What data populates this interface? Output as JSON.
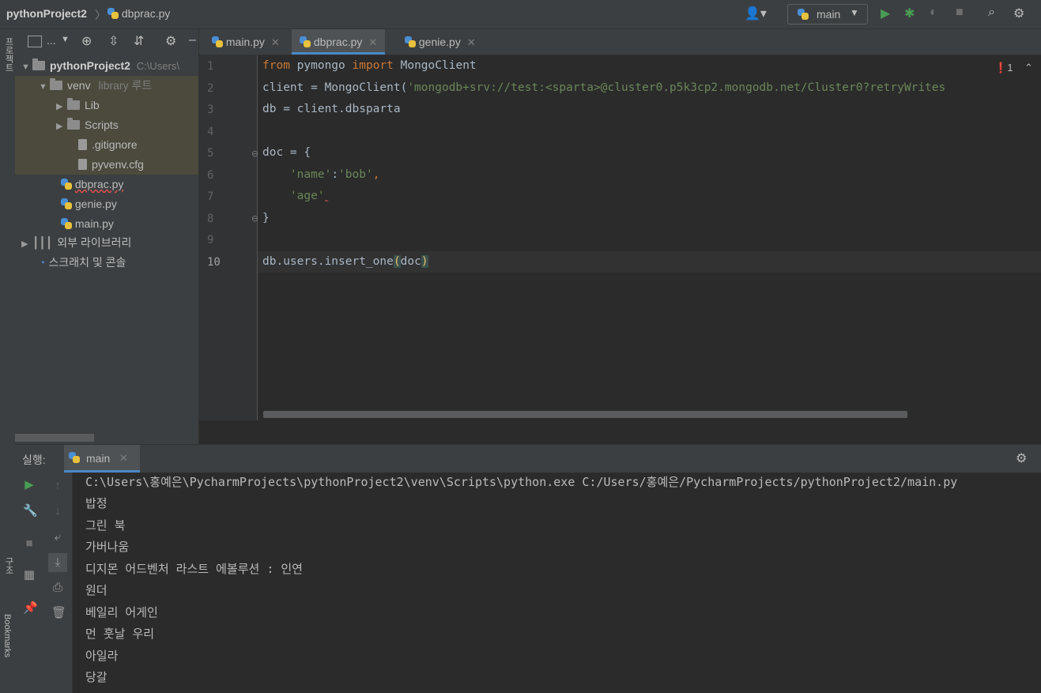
{
  "titlebar": {
    "project": "pythonProject2",
    "file": "dbprac.py",
    "run_config": "main"
  },
  "left_strip": {
    "project_label": "프로젝트",
    "structure_label": "구조",
    "bookmarks_label": "Bookmarks"
  },
  "project_tree": {
    "toolbar_label": "...",
    "root": {
      "name": "pythonProject2",
      "path": "C:\\Users\\"
    },
    "venv": {
      "name": "venv",
      "tag": "library 루트"
    },
    "items": [
      {
        "name": "Lib"
      },
      {
        "name": "Scripts"
      },
      {
        "name": ".gitignore"
      },
      {
        "name": "pyvenv.cfg"
      },
      {
        "name": "dbprac.py"
      },
      {
        "name": "genie.py"
      },
      {
        "name": "main.py"
      }
    ],
    "external_libs": "외부 라이브러리",
    "scratches": "스크래치 및 콘솔"
  },
  "tabs": [
    {
      "label": "main.py"
    },
    {
      "label": "dbprac.py"
    },
    {
      "label": "genie.py"
    }
  ],
  "editor": {
    "error_count": "1",
    "line_numbers": [
      "1",
      "2",
      "3",
      "4",
      "5",
      "6",
      "7",
      "8",
      "9",
      "10"
    ],
    "lines": {
      "l1_kw1": "from",
      "l1_mod": " pymongo ",
      "l1_kw2": "import",
      "l1_cls": " MongoClient",
      "l2_pre": "client = MongoClient(",
      "l2_str": "'mongodb+srv://test:<sparta>@cluster0.p5k3cp2.mongodb.net/Cluster0?retryWrites",
      "l3": "db = client.dbsparta",
      "l5": "doc = {",
      "l6_key": "    'name'",
      "l6_colon": ":",
      "l6_val": "'bob'",
      "l6_comma": ",",
      "l7_key": "    'age'",
      "l8": "}",
      "l10_pre": "db.users.insert_one",
      "l10_open": "(",
      "l10_arg": "doc",
      "l10_close": ")"
    }
  },
  "run_panel": {
    "label": "실행:",
    "tab": "main",
    "output": [
      "C:\\Users\\홍예은\\PycharmProjects\\pythonProject2\\venv\\Scripts\\python.exe C:/Users/홍예은/PycharmProjects/pythonProject2/main.py",
      "밥정",
      "그린 북",
      "가버나움",
      "디지몬 어드벤처 라스트 에볼루션 : 인연",
      "원더",
      "베일리 어게인",
      "먼 훗날 우리",
      "아일라",
      "당갈"
    ]
  },
  "colors": {
    "keyword": "#cc7832",
    "string": "#6a8759",
    "text": "#a9b7c6",
    "run_green": "#499c54",
    "error_red": "#e0524f"
  }
}
